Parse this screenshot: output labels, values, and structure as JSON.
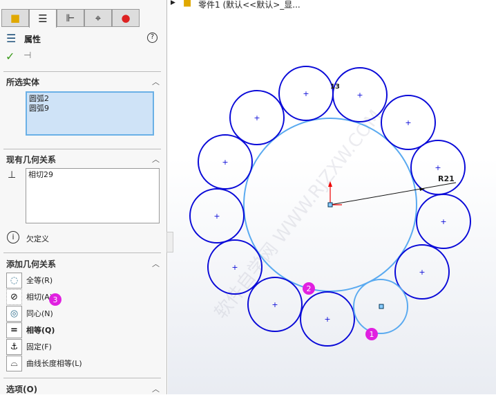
{
  "tabs": [
    "feature-manager",
    "property-manager",
    "configuration-manager",
    "dimxpert",
    "display-manager"
  ],
  "header": {
    "title": "属性",
    "help": "?"
  },
  "selected": {
    "title": "所选实体",
    "items": [
      "圆弧2",
      "圆弧9"
    ]
  },
  "existing": {
    "title": "现有几何关系",
    "items": [
      "相切29"
    ],
    "status": "欠定义"
  },
  "add": {
    "title": "添加几何关系",
    "items": [
      {
        "label": "全等(R)",
        "icon": "◌",
        "bold": false
      },
      {
        "label": "相切(A)",
        "icon": "⊘",
        "bold": false
      },
      {
        "label": "同心(N)",
        "icon": "◎",
        "bold": false
      },
      {
        "label": "相等(Q)",
        "icon": "=",
        "bold": true
      },
      {
        "label": "固定(F)",
        "icon": "⚓",
        "bold": false
      },
      {
        "label": "曲线长度相等(L)",
        "icon": "⌓",
        "bold": false
      }
    ]
  },
  "options": {
    "title": "选项(O)"
  },
  "tree": {
    "label": "零件1  (默认<<默认>_显..."
  },
  "sketch": {
    "dim_radius": "R21",
    "dim_count": "13",
    "badges": [
      "1",
      "2",
      "3"
    ],
    "watermark": "软件自学网 WWW.RJZXW.COM"
  },
  "colors": {
    "circle": "#0a0ad8",
    "selected": "#5aaaf0",
    "badge": "#e020e0"
  }
}
